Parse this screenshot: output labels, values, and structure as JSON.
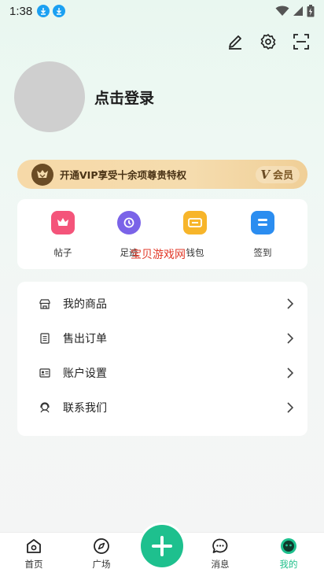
{
  "status_bar": {
    "time": "1:38"
  },
  "profile": {
    "login_text": "点击登录"
  },
  "vip": {
    "text": "开通VIP享受十余项尊贵特权",
    "badge_v": "V",
    "badge_label": "会员"
  },
  "quick_actions": [
    {
      "label": "帖子",
      "icon": "posts-icon",
      "color": "#f4547a"
    },
    {
      "label": "足迹",
      "icon": "footprint-icon",
      "color": "#7a63e8"
    },
    {
      "label": "钱包",
      "icon": "wallet-icon",
      "color": "#f7b52a"
    },
    {
      "label": "签到",
      "icon": "checkin-icon",
      "color": "#2b8df0"
    }
  ],
  "watermark": "宝贝游戏网",
  "menu": [
    {
      "label": "我的商品",
      "icon": "store-icon"
    },
    {
      "label": "售出订单",
      "icon": "order-icon"
    },
    {
      "label": "账户设置",
      "icon": "account-icon"
    },
    {
      "label": "联系我们",
      "icon": "support-icon"
    }
  ],
  "tabs": [
    {
      "label": "首页",
      "icon": "home-icon"
    },
    {
      "label": "广场",
      "icon": "compass-icon"
    },
    {
      "label": "消息",
      "icon": "message-icon"
    },
    {
      "label": "我的",
      "icon": "mine-icon",
      "active": true
    }
  ],
  "colors": {
    "accent": "#1ec08e",
    "vip_gold": "#f5dcae",
    "vip_brown": "#6b4c25"
  }
}
